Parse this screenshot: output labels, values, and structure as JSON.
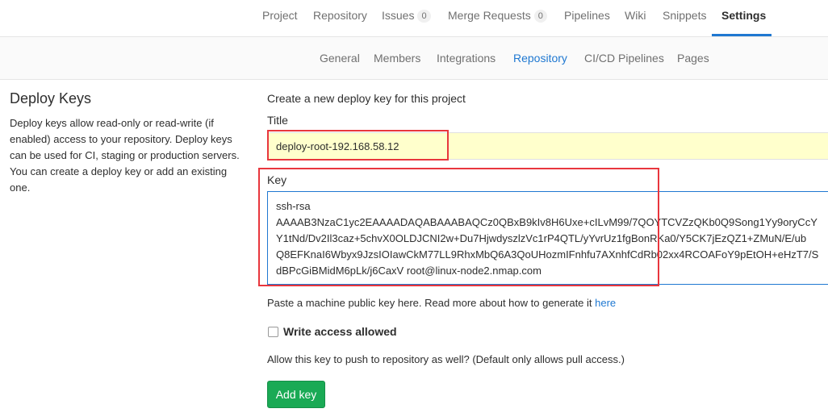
{
  "top_nav": {
    "items": [
      {
        "label": "Project"
      },
      {
        "label": "Repository"
      },
      {
        "label": "Issues",
        "count": "0"
      },
      {
        "label": "Merge Requests",
        "count": "0"
      },
      {
        "label": "Pipelines"
      },
      {
        "label": "Wiki"
      },
      {
        "label": "Snippets"
      },
      {
        "label": "Settings",
        "active": true
      }
    ],
    "active_color": "#1f78d1"
  },
  "sub_nav": {
    "items": [
      {
        "label": "General"
      },
      {
        "label": "Members"
      },
      {
        "label": "Integrations"
      },
      {
        "label": "Repository",
        "active": true
      },
      {
        "label": "CI/CD Pipelines"
      },
      {
        "label": "Pages"
      }
    ]
  },
  "section": {
    "title": "Deploy Keys",
    "description": "Deploy keys allow read-only or read-write (if enabled) access to your repository. Deploy keys can be used for CI, staging or production servers. You can create a deploy key or add an existing one."
  },
  "form": {
    "heading": "Create a new deploy key for this project",
    "title_label": "Title",
    "title_value": "deploy-root-192.168.58.12",
    "key_label": "Key",
    "key_value": "ssh-rsa\nAAAAB3NzaC1yc2EAAAADAQABAAABAQCz0QBxB9kIv8H6Uxe+cILvM99/7QOYTCVZzQKb0Q9Song1Yy9oryCcY\nY1tNd/Dv2Il3caz+5chvX0OLDJCNI2w+Du7HjwdyszlzVc1rP4QTL/yYvrUz1fgBonRKa0/Y5CK7jEzQZ1+ZMuN/E/ub\nQ8EFKnaI6Wbyx9JzsIOIawCkM77LL9RhxMbQ6A3QoUHozmIFnhfu7AXnhfCdRb02xx4RCOAFoY9pEtOH+eHzT7/S\ndBPcGiBMidM6pLk/j6CaxV root@linux-node2.nmap.com",
    "hint_text": "Paste a machine public key here. Read more about how to generate it ",
    "hint_link": "here",
    "checkbox_label": "Write access allowed",
    "checkbox_checked": false,
    "allow_text": "Allow this key to push to repository as well? (Default only allows pull access.)",
    "submit_label": "Add key"
  },
  "colors": {
    "highlight_annotation": "#e8363d",
    "title_input_bg": "#ffffcc",
    "submit_bg": "#1aaa55",
    "link": "#1f78d1"
  }
}
